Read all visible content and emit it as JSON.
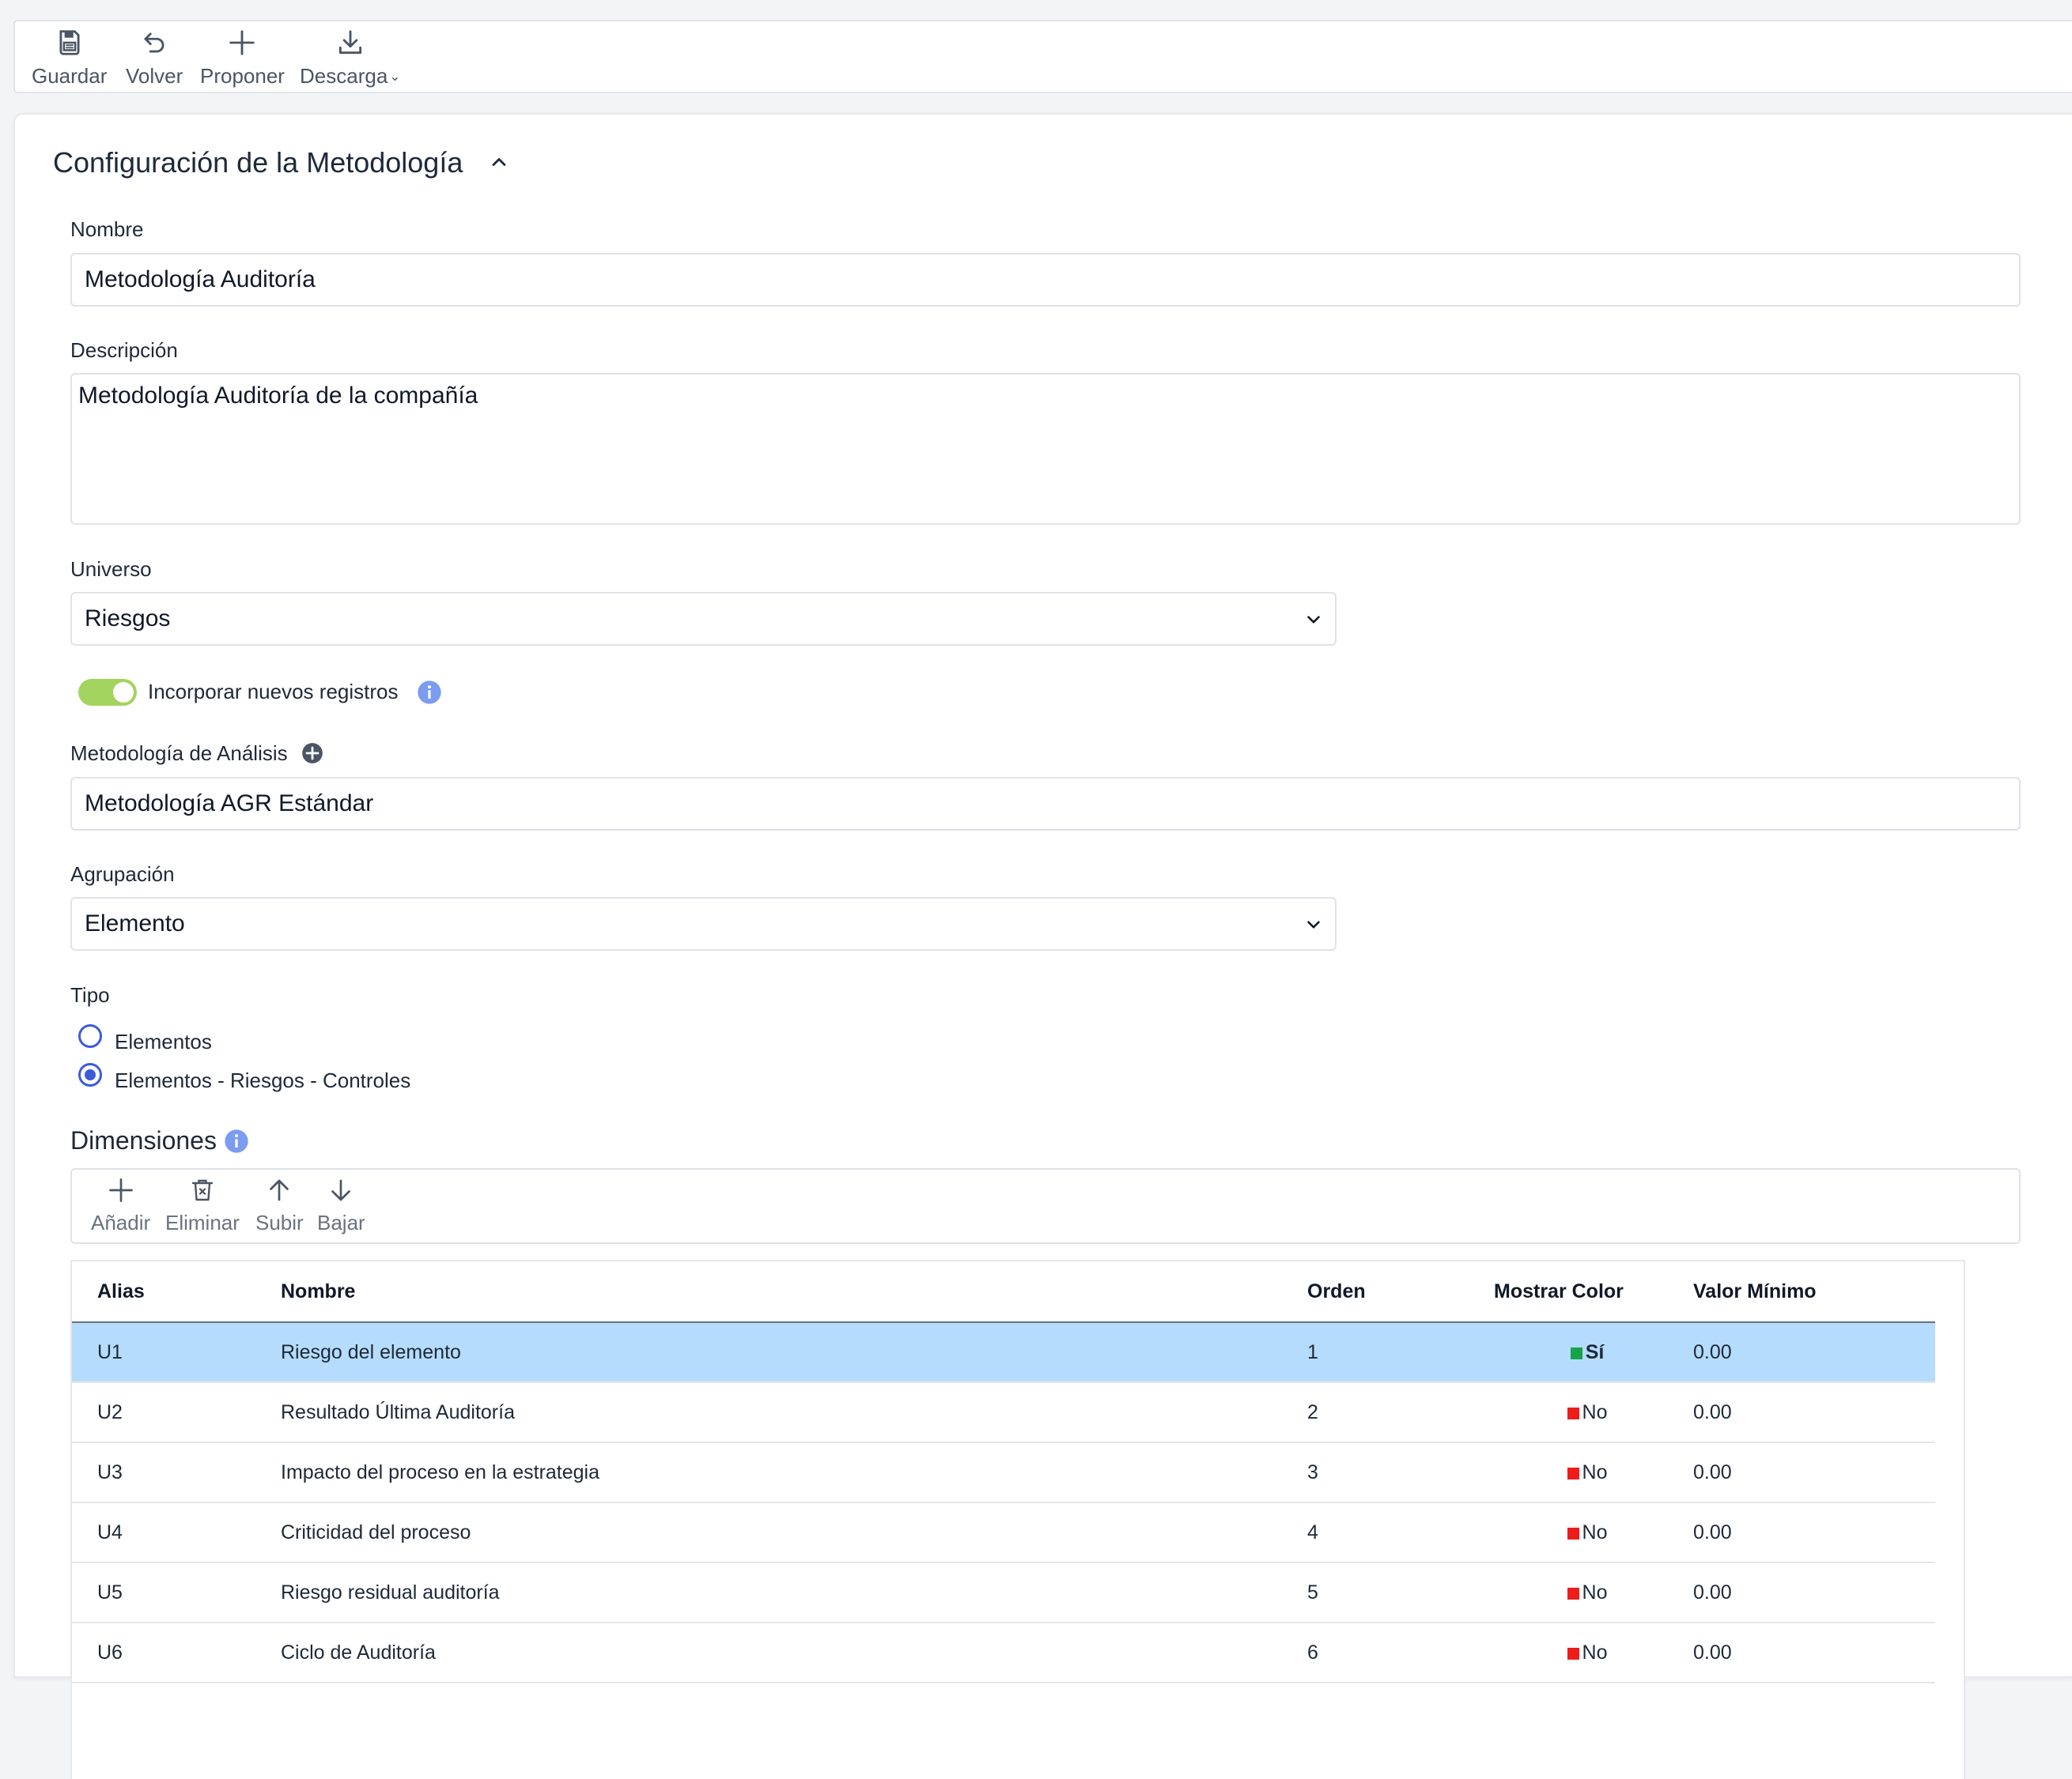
{
  "toolbar": {
    "save": "Guardar",
    "back": "Volver",
    "propose": "Proponer",
    "download": "Descarga"
  },
  "panel": {
    "title": "Configuración de la Metodología"
  },
  "form": {
    "name_label": "Nombre",
    "name_value": "Metodología Auditoría",
    "description_label": "Descripción",
    "description_value": "Metodología Auditoría de la compañía",
    "universe_label": "Universo",
    "universe_value": "Riesgos",
    "incorporate_label": "Incorporar nuevos registros",
    "incorporate_on": true,
    "analysis_label": "Metodología de Análisis",
    "analysis_value": "Metodología AGR Estándar",
    "grouping_label": "Agrupación",
    "grouping_value": "Elemento",
    "type_label": "Tipo",
    "type_options": [
      "Elementos",
      "Elementos - Riesgos - Controles"
    ],
    "type_selected": "Elementos - Riesgos - Controles"
  },
  "dimensions": {
    "title": "Dimensiones",
    "toolbar": {
      "add": "Añadir",
      "delete": "Eliminar",
      "up": "Subir",
      "down": "Bajar"
    },
    "columns": [
      "Alias",
      "Nombre",
      "Orden",
      "Mostrar Color",
      "Valor Mínimo"
    ],
    "rows": [
      {
        "alias": "U1",
        "name": "Riesgo del elemento",
        "order": "1",
        "color": "Sí",
        "min": "0.00",
        "swatch": "#16a34a"
      },
      {
        "alias": "U2",
        "name": "Resultado Última Auditoría",
        "order": "2",
        "color": "No",
        "min": "0.00",
        "swatch": "#ef1c1c"
      },
      {
        "alias": "U3",
        "name": "Impacto del proceso en la estrategia",
        "order": "3",
        "color": "No",
        "min": "0.00",
        "swatch": "#ef1c1c"
      },
      {
        "alias": "U4",
        "name": "Criticidad del proceso",
        "order": "4",
        "color": "No",
        "min": "0.00",
        "swatch": "#ef1c1c"
      },
      {
        "alias": "U5",
        "name": "Riesgo residual auditoría",
        "order": "5",
        "color": "No",
        "min": "0.00",
        "swatch": "#ef1c1c"
      },
      {
        "alias": "U6",
        "name": "Ciclo de Auditoría",
        "order": "6",
        "color": "No",
        "min": "0.00",
        "swatch": "#ef1c1c"
      }
    ]
  },
  "colors": {
    "accent": "#3b5bdb",
    "toggle_on": "#a3d45f",
    "selected_row": "#b5dcfc",
    "info_icon": "#7b9cf0"
  },
  "icons": [
    "save-icon",
    "undo-icon",
    "plus-icon",
    "download-icon",
    "chevron-up-icon",
    "chevron-down-icon",
    "info-icon",
    "plus-circle-icon",
    "trash-icon",
    "arrow-up-icon",
    "arrow-down-icon"
  ]
}
